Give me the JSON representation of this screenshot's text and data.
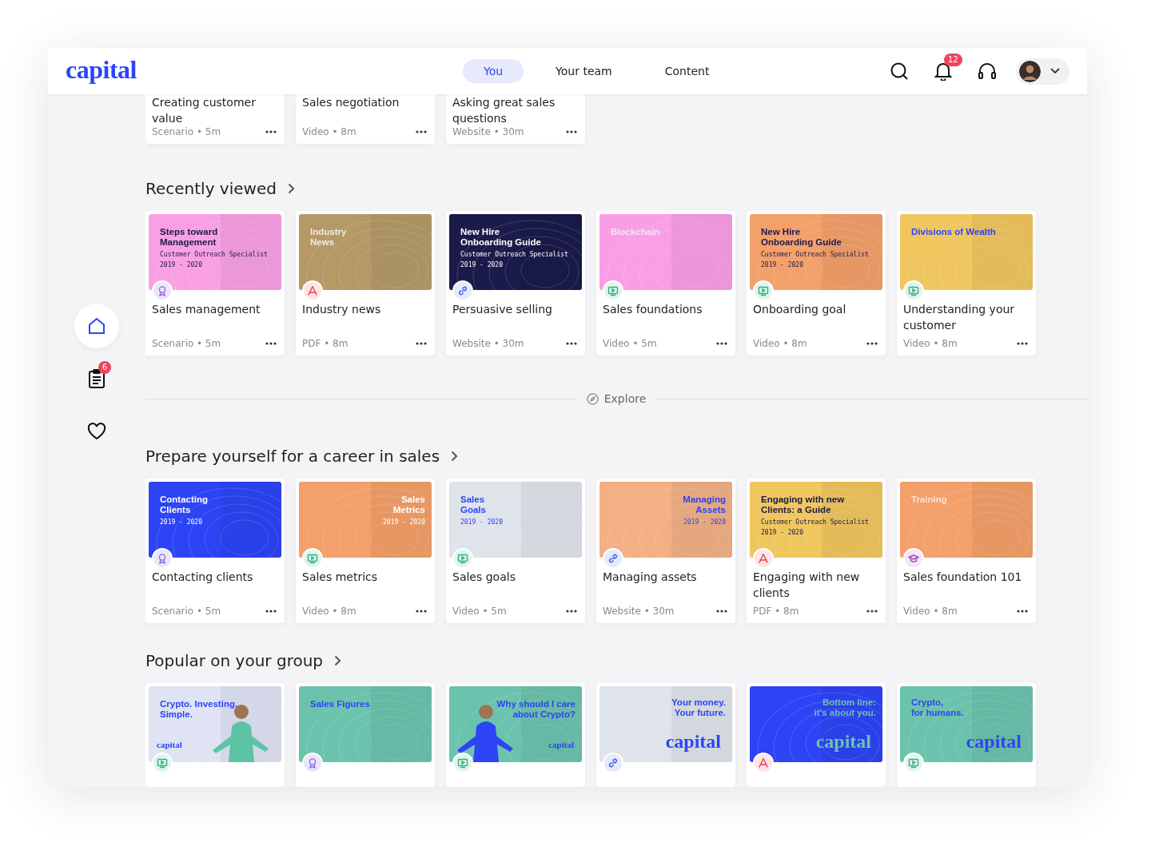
{
  "header": {
    "logo": "capital",
    "tabs": [
      {
        "label": "You",
        "selected": true
      },
      {
        "label": "Your team",
        "selected": false
      },
      {
        "label": "Content",
        "selected": false
      }
    ],
    "notifications": "12"
  },
  "sidebar": {
    "items": [
      {
        "kind": "home",
        "selected": true
      },
      {
        "kind": "tasks",
        "selected": false,
        "badge": "6"
      },
      {
        "kind": "favorites",
        "selected": false
      }
    ]
  },
  "partial_row": [
    {
      "title": "Creating customer value",
      "meta": "Scenario • 5m"
    },
    {
      "title": "Sales negotiation",
      "meta": "Video • 8m"
    },
    {
      "title": "Asking great sales questions",
      "meta": "Website • 30m"
    }
  ],
  "sections": [
    {
      "title": "Recently viewed",
      "cards": [
        {
          "title": "Sales management",
          "meta": "Scenario • 5m",
          "kind": "scenario",
          "thumb": {
            "color": "#f9a0e3",
            "heading": {
              "kind": "left",
              "color": "#1b1b4b",
              "lines": [
                "Steps toward",
                "Management"
              ]
            },
            "note": "Customer Outreach Specialist",
            "years": "2019 - 2020"
          }
        },
        {
          "title": "Industry news",
          "meta": "PDF • 8m",
          "kind": "pdf",
          "thumb": {
            "color": "#b59a68",
            "heading": {
              "kind": "left",
              "color": "#f1ebe0",
              "lines": [
                "Industry",
                "News"
              ]
            }
          }
        },
        {
          "title": "Persuasive selling",
          "meta": "Website • 30m",
          "kind": "website",
          "thumb": {
            "color": "#1b1b4b",
            "heading": {
              "kind": "left",
              "color": "#ffffff",
              "lines": [
                "New Hire",
                "Onboarding Guide"
              ]
            },
            "note": "Customer Outreach Specialist",
            "years": "2019 - 2020"
          }
        },
        {
          "title": "Sales foundations",
          "meta": "Video • 5m",
          "kind": "video",
          "thumb": {
            "color": "#f99ee6",
            "heading": {
              "kind": "left",
              "color": "#f4e4ef",
              "lines": [
                "Blockchain"
              ]
            }
          }
        },
        {
          "title": "Onboarding goal",
          "meta": "Video • 8m",
          "kind": "video",
          "thumb": {
            "color": "#f4a06a",
            "heading": {
              "kind": "left",
              "color": "#1b1b4b",
              "lines": [
                "New Hire",
                "Onboarding Guide"
              ]
            },
            "note": "Customer Outreach Specialist",
            "years": "2019 - 2020"
          }
        },
        {
          "title": "Understanding your customer",
          "meta": "Video • 8m",
          "kind": "video",
          "thumb": {
            "color": "#f0c75e",
            "heading": {
              "kind": "left",
              "color": "#2d44f5",
              "lines": [
                "Divisions of Wealth"
              ]
            }
          }
        }
      ]
    },
    {
      "title": "Prepare yourself for a career in sales",
      "cards": [
        {
          "title": "Contacting clients",
          "meta": "Scenario • 5m",
          "kind": "scenario",
          "thumb": {
            "color": "#2d44f5",
            "heading": {
              "kind": "left",
              "color": "#ffffff",
              "lines": [
                "Contacting",
                "Clients"
              ]
            },
            "years": "2019 - 2020"
          }
        },
        {
          "title": "Sales metrics",
          "meta": "Video • 8m",
          "kind": "video",
          "thumb": {
            "color": "#f4a06a",
            "heading": {
              "kind": "right",
              "color": "#ffffff",
              "lines": [
                "Sales",
                "Metrics"
              ]
            },
            "years": "2019 - 2020"
          }
        },
        {
          "title": "Sales goals",
          "meta": "Video • 5m",
          "kind": "video",
          "thumb": {
            "color": "#dfe3ea",
            "heading": {
              "kind": "left",
              "color": "#2d44f5",
              "lines": [
                "Sales",
                "Goals"
              ]
            },
            "years": "2019 - 2020"
          }
        },
        {
          "title": "Managing assets",
          "meta": "Website • 30m",
          "kind": "website",
          "thumb": {
            "color": "#f2b084",
            "heading": {
              "kind": "right",
              "color": "#2d44f5",
              "lines": [
                "Managing",
                "Assets"
              ]
            },
            "years": "2019 - 2020"
          }
        },
        {
          "title": "Engaging with new clients",
          "meta": "PDF • 8m",
          "kind": "pdf",
          "thumb": {
            "color": "#f0c75e",
            "heading": {
              "kind": "left",
              "color": "#1b1b4b",
              "lines": [
                "Engaging with new",
                "Clients: a Guide"
              ]
            },
            "note": "Customer Outreach Specialist",
            "years": "2019 - 2020"
          }
        },
        {
          "title": "Sales foundation 101",
          "meta": "Video • 8m",
          "kind": "course",
          "thumb": {
            "color": "#f4a06a",
            "heading": {
              "kind": "left",
              "color": "#fbe3d2",
              "lines": [
                "Training"
              ]
            }
          }
        }
      ]
    },
    {
      "title": "Popular on your group",
      "cards": [
        {
          "kind": "video",
          "thumb": {
            "color": "#dfe3f4",
            "figure": true,
            "heading": {
              "kind": "left",
              "color": "#2d44f5",
              "lines": [
                "Crypto. Investing.",
                "Simple."
              ]
            },
            "logo": {
              "kind": "small",
              "color": "#2d44f5",
              "text": "capital"
            }
          }
        },
        {
          "kind": "scenario",
          "thumb": {
            "color": "#6cc3ad",
            "heading": {
              "kind": "left",
              "color": "#2d44f5",
              "lines": [
                "Sales Figures"
              ]
            }
          }
        },
        {
          "kind": "video",
          "thumb": {
            "color": "#6cc3ad",
            "figure": true,
            "heading": {
              "kind": "right",
              "color": "#2d44f5",
              "lines": [
                "Why should I care",
                "about Crypto?"
              ]
            },
            "logo": {
              "kind": "small",
              "color": "#2d44f5",
              "text": "capital"
            }
          }
        },
        {
          "kind": "website",
          "thumb": {
            "color": "#dfe3ea",
            "heading": {
              "kind": "right",
              "color": "#2d44f5",
              "lines": [
                "Your money.",
                "Your future."
              ]
            },
            "logo": {
              "kind": "big",
              "color": "#2d44f5",
              "text": "capital"
            }
          }
        },
        {
          "kind": "pdf",
          "thumb": {
            "color": "#2d44f5",
            "heading": {
              "kind": "right",
              "color": "#6cc3ad",
              "lines": [
                "Bottom line:",
                "it's about you."
              ]
            },
            "logo": {
              "kind": "big",
              "color": "#6cc3ad",
              "text": "capital"
            }
          }
        },
        {
          "kind": "video",
          "thumb": {
            "color": "#6cc3ad",
            "heading": {
              "kind": "left",
              "color": "#2d44f5",
              "lines": [
                "Crypto,",
                "for humans."
              ]
            },
            "logo": {
              "kind": "big",
              "color": "#2d44f5",
              "text": "capital"
            }
          }
        }
      ]
    }
  ],
  "explore": "Explore"
}
